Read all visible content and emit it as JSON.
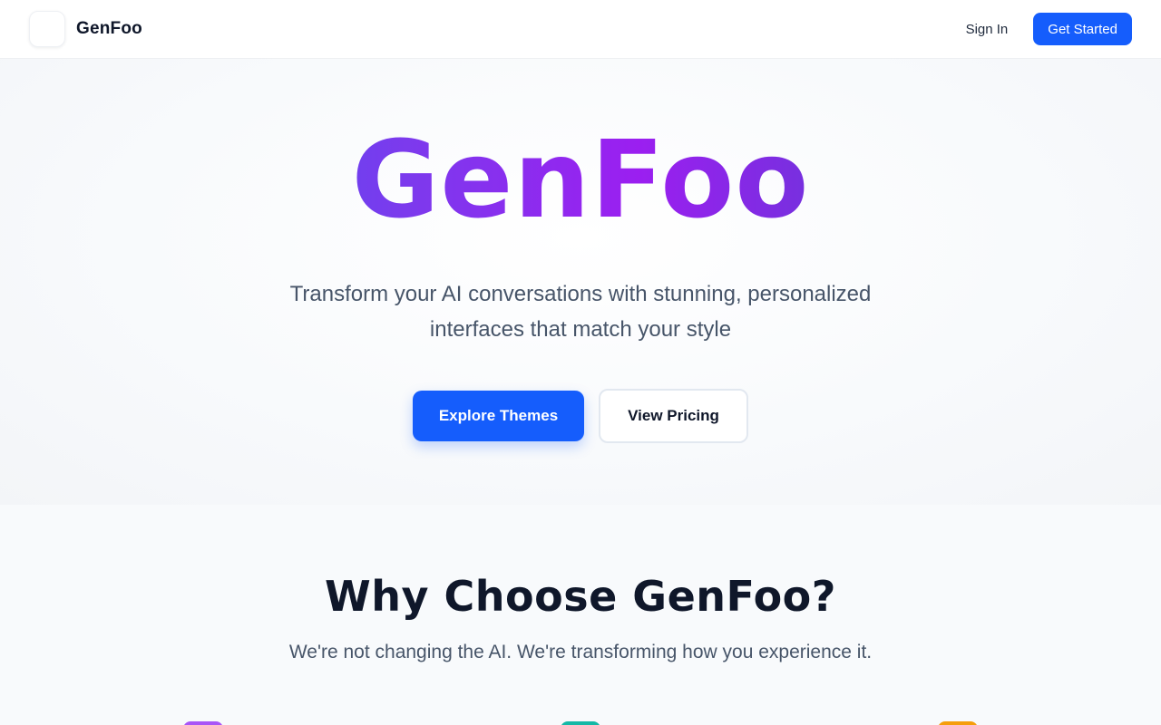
{
  "header": {
    "brand_name": "GenFoo",
    "sign_in_label": "Sign In",
    "get_started_label": "Get Started"
  },
  "hero": {
    "title": "GenFoo",
    "subtitle_line1": "Transform your AI conversations with stunning, personalized",
    "subtitle_line2": "interfaces that match your style",
    "explore_label": "Explore Themes",
    "pricing_label": "View Pricing"
  },
  "why": {
    "title": "Why Choose GenFoo?",
    "subtitle": "We're not changing the AI. We're transforming how you experience it."
  },
  "colors": {
    "accent": "#155dfc",
    "feature_icon_1": "#a855f7",
    "feature_icon_2": "#14b8a6",
    "feature_icon_3": "#f59e0b"
  }
}
